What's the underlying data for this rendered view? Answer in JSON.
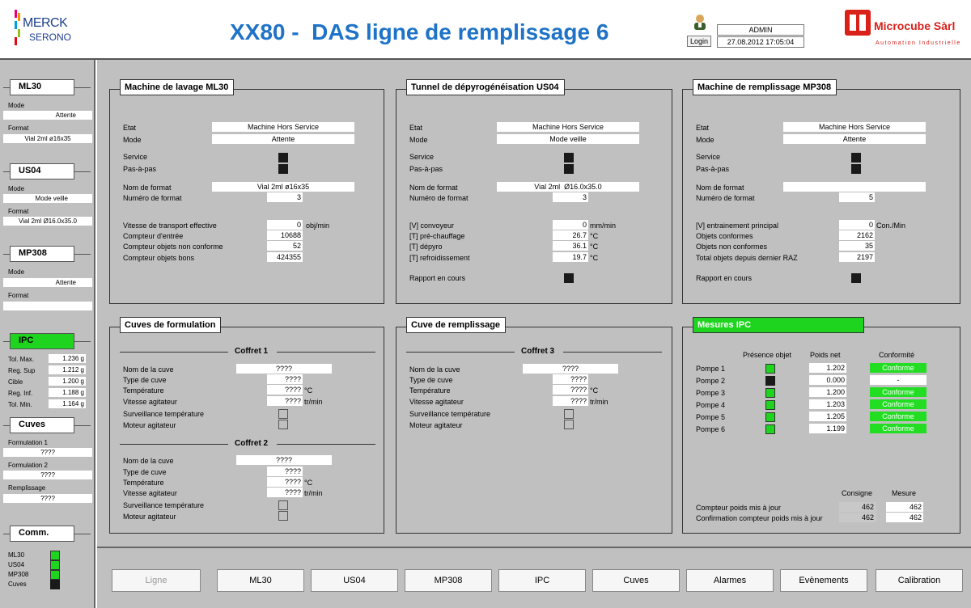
{
  "header": {
    "title": "XX80 -  DAS ligne de remplissage 6",
    "logo_merck_1": "MERCK",
    "logo_merck_2": "SERONO",
    "user": "ADMIN",
    "login": "Login",
    "datetime": "27.08.2012 17:05:04",
    "brand": "Microcube Sàrl",
    "brand_sub": "Automation Industrielle"
  },
  "sidebar": {
    "ml30": {
      "title": "ML30",
      "mode_label": "Mode",
      "mode": "Attente",
      "format_label": "Format",
      "format": "Vial 2ml ø16x35"
    },
    "us04": {
      "title": "US04",
      "mode_label": "Mode",
      "mode": "Mode veille",
      "format_label": "Format",
      "format": "Vial 2ml  Ø16.0x35.0"
    },
    "mp308": {
      "title": "MP308",
      "mode_label": "Mode",
      "mode": "Attente",
      "format_label": "Format",
      "format": ""
    },
    "ipc": {
      "title": "IPC",
      "rows": [
        {
          "label": "Tol. Max.",
          "value": "1.236",
          "unit": "g"
        },
        {
          "label": "Reg. Sup",
          "value": "1.212",
          "unit": "g"
        },
        {
          "label": "Cible",
          "value": "1.200",
          "unit": "g"
        },
        {
          "label": "Reg. Inf.",
          "value": "1.188",
          "unit": "g"
        },
        {
          "label": "Tol. Min.",
          "value": "1.164",
          "unit": "g"
        }
      ]
    },
    "cuves": {
      "title": "Cuves",
      "f1_label": "Formulation 1",
      "f1": "????",
      "f2_label": "Formulation 2",
      "f2": "????",
      "r_label": "Remplissage",
      "r": "????"
    },
    "comm": {
      "title": "Comm.",
      "items": [
        {
          "label": "ML30"
        },
        {
          "label": "US04"
        },
        {
          "label": "MP308"
        },
        {
          "label": "Cuves"
        }
      ]
    }
  },
  "ml30": {
    "title": "Machine de lavage ML30",
    "etat_l": "Etat",
    "etat": "Machine Hors Service",
    "mode_l": "Mode",
    "mode": "Attente",
    "service_l": "Service",
    "pap_l": "Pas-à-pas",
    "nomf_l": "Nom de format",
    "nomf": "Vial 2ml ø16x35",
    "numf_l": "Numéro de format",
    "numf": "3",
    "vit_l": "Vitesse de transport effective",
    "vit": "0",
    "vit_u": "obj/min",
    "ce_l": "Compteur d'entrée",
    "ce": "10688",
    "cnc_l": "Compteur objets non conforme",
    "cnc": "52",
    "cob_l": "Compteur objets bons",
    "cob": "424355"
  },
  "us04": {
    "title": "Tunnel de dépyrogénéisation US04",
    "etat_l": "Etat",
    "etat": "Machine Hors Service",
    "mode_l": "Mode",
    "mode": "Mode veille",
    "service_l": "Service",
    "pap_l": "Pas-à-pas",
    "nomf_l": "Nom de format",
    "nomf": "Vial 2ml  Ø16.0x35.0",
    "numf_l": "Numéro de format",
    "numf": "3",
    "conv_l": "[V] convoyeur",
    "conv": "0",
    "conv_u": "mm/min",
    "pre_l": "[T] pré-chauffage",
    "pre": "26.7",
    "pre_u": "°C",
    "dep_l": "[T] dépyro",
    "dep": "36.1",
    "dep_u": "°C",
    "ref_l": "[T] refroidissement",
    "ref": "19.7",
    "ref_u": "°C",
    "rap_l": "Rapport en cours"
  },
  "mp308": {
    "title": "Machine de remplissage MP308",
    "etat_l": "Etat",
    "etat": "Machine Hors Service",
    "mode_l": "Mode",
    "mode": "Attente",
    "service_l": "Service",
    "pap_l": "Pas-à-pas",
    "nomf_l": "Nom de format",
    "nomf": "",
    "numf_l": "Numéro de format",
    "numf": "5",
    "ent_l": "[V] entrainement principal",
    "ent": "0",
    "ent_u": "Con./Min",
    "oc_l": "Objets conformes",
    "oc": "2162",
    "onc_l": "Objets non conformes",
    "onc": "35",
    "tot_l": "Total objets depuis dernier RAZ",
    "tot": "2197",
    "rap_l": "Rapport en cours"
  },
  "cuves_form": {
    "title": "Cuves de formulation",
    "c1": "Coffret 1",
    "c2": "Coffret 2",
    "nom_l": "Nom de la cuve",
    "type_l": "Type de cuve",
    "temp_l": "Température",
    "vit_l": "Vitesse agitateur",
    "surv_l": "Surveillance température",
    "mot_l": "Moteur agitateur",
    "v": "????",
    "temp_u": "°C",
    "vit_u": "tr/min"
  },
  "cuve_remp": {
    "title": "Cuve de remplissage",
    "c3": "Coffret 3",
    "nom_l": "Nom de la cuve",
    "type_l": "Type de cuve",
    "temp_l": "Température",
    "vit_l": "Vitesse agitateur",
    "surv_l": "Surveillance température",
    "mot_l": "Moteur agitateur",
    "v": "????",
    "temp_u": "°C",
    "vit_u": "tr/min"
  },
  "ipc": {
    "title": "Mesures IPC",
    "h_presence": "Présence objet",
    "h_poids": "Poids net",
    "h_conf": "Conformité",
    "pumps": [
      {
        "label": "Pompe 1",
        "poids": "1.202",
        "conf": "Conforme"
      },
      {
        "label": "Pompe 2",
        "poids": "0.000",
        "conf": "-"
      },
      {
        "label": "Pompe 3",
        "poids": "1.200",
        "conf": "Conforme"
      },
      {
        "label": "Pompe 4",
        "poids": "1.203",
        "conf": "Conforme"
      },
      {
        "label": "Pompe 5",
        "poids": "1.205",
        "conf": "Conforme"
      },
      {
        "label": "Pompe 6",
        "poids": "1.199",
        "conf": "Conforme"
      }
    ],
    "h_consigne": "Consigne",
    "h_mesure": "Mesure",
    "cp_l": "Compteur poids mis à jour",
    "cp_c": "462",
    "cp_m": "462",
    "conf_l": "Confirmation compteur poids mis à jour",
    "conf_c": "462",
    "conf_m": "462"
  },
  "nav": {
    "ligne": "Ligne",
    "ml30": "ML30",
    "us04": "US04",
    "mp308": "MP308",
    "ipc": "IPC",
    "cuves": "Cuves",
    "alarmes": "Alarmes",
    "evenements": "Evènements",
    "calibration": "Calibration"
  },
  "colors": {
    "accent": "#1e73c8",
    "green": "#1ed41e",
    "panel": "#c0c0c0",
    "brand_red": "#d9211a"
  }
}
